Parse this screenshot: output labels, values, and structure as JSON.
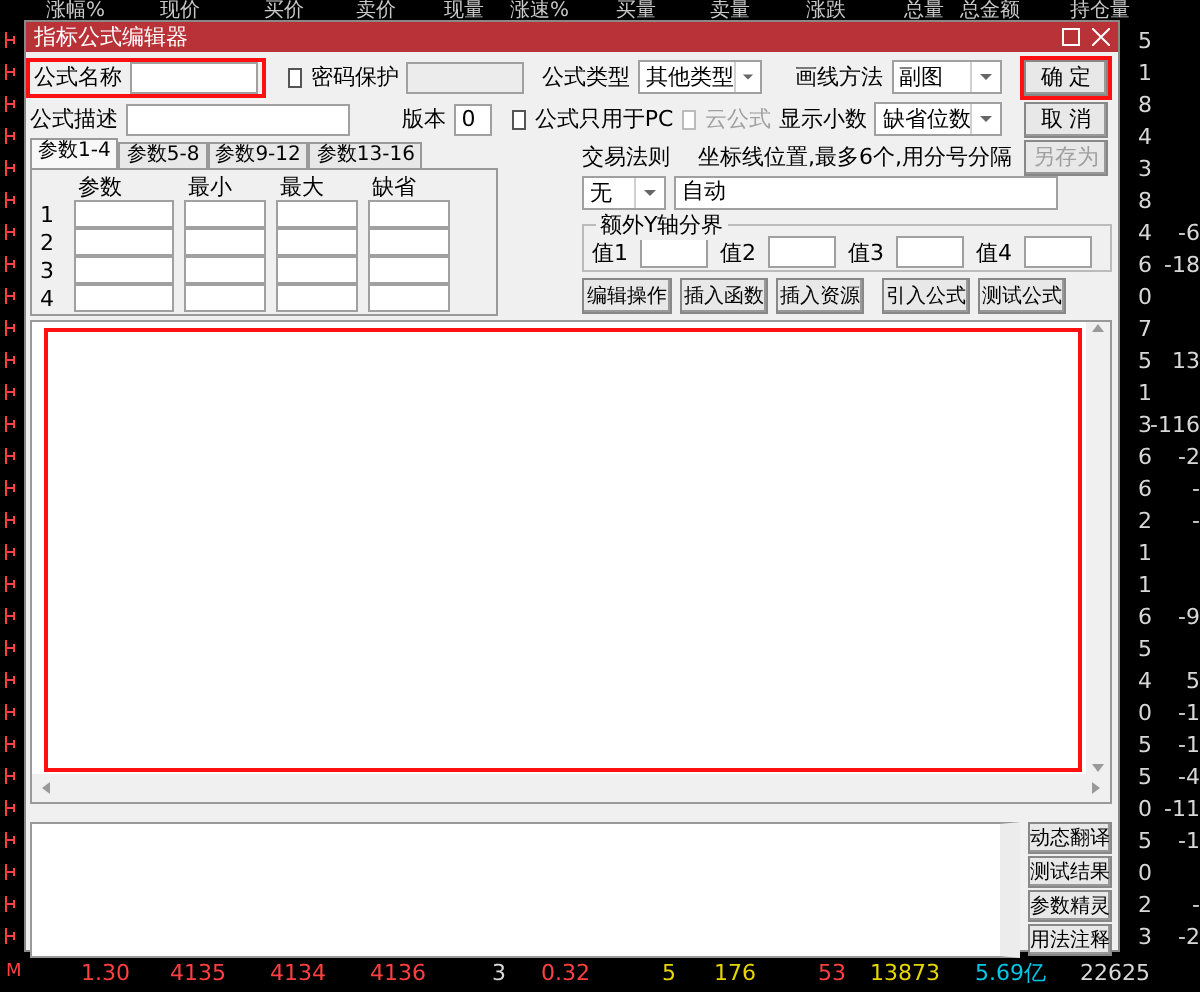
{
  "market": {
    "header": [
      "涨幅%",
      "现价",
      "买价",
      "卖价",
      "现量",
      "涨速%",
      "买量",
      "卖量",
      "涨跌",
      "总量",
      "总金额",
      "持仓量"
    ],
    "rows": [
      {
        "c1": "5"
      },
      {
        "c1": "1"
      },
      {
        "c1": "8"
      },
      {
        "c1": "4"
      },
      {
        "c1": "3"
      },
      {
        "c1": "8"
      },
      {
        "c1": "4",
        "c2": "-6"
      },
      {
        "c1": "6",
        "c2": "-18"
      },
      {
        "c1": "0"
      },
      {
        "c1": "7"
      },
      {
        "c1": "5",
        "c2": "13"
      },
      {
        "c1": "1"
      },
      {
        "c1": "3",
        "c2": "-116"
      },
      {
        "c1": "6",
        "c2": "-2"
      },
      {
        "c1": "6",
        "c2": "-"
      },
      {
        "c1": "2",
        "c2": "-"
      },
      {
        "c1": "1"
      },
      {
        "c1": "1"
      },
      {
        "c1": "6",
        "c2": "-9"
      },
      {
        "c1": "5"
      },
      {
        "c1": "4",
        "c2": "5"
      },
      {
        "c1": "0",
        "c2": "-1"
      },
      {
        "c1": "5",
        "c2": "-1"
      },
      {
        "c1": "5",
        "c2": "-4"
      },
      {
        "c1": "0",
        "c2": "-11"
      },
      {
        "c1": "5",
        "c2": "-1"
      },
      {
        "c1": "0"
      },
      {
        "c1": "2",
        "c2": "-"
      },
      {
        "c1": "3",
        "c2": "-2"
      }
    ],
    "footer_marker": "M",
    "footer": [
      {
        "text": "1.30",
        "color": "#ff4040"
      },
      {
        "text": "4135",
        "color": "#ff4040"
      },
      {
        "text": "4134",
        "color": "#ff4040"
      },
      {
        "text": "4136",
        "color": "#ff4040"
      },
      {
        "text": "3",
        "color": "#d8d8d8"
      },
      {
        "text": "0.32",
        "color": "#ff4040"
      },
      {
        "text": "5",
        "color": "#e6d600"
      },
      {
        "text": "176",
        "color": "#e6d600"
      },
      {
        "text": "53",
        "color": "#ff4040"
      },
      {
        "text": "13873",
        "color": "#e6d600"
      },
      {
        "text": "5.69亿",
        "color": "#00c8e6"
      },
      {
        "text": "22625",
        "color": "#d8d8d8"
      }
    ]
  },
  "dialog": {
    "title": "指标公式编辑器",
    "name_field": {
      "label": "公式名称",
      "highlighted": true
    },
    "password": {
      "label": "密码保护",
      "checked": false
    },
    "formula_type": {
      "label": "公式类型",
      "value": "其他类型"
    },
    "draw_method": {
      "label": "画线方法",
      "value": "副图"
    },
    "description": {
      "label": "公式描述"
    },
    "version": {
      "label": "版本",
      "value": "0"
    },
    "pc_only": {
      "label": "公式只用于PC",
      "checked": false
    },
    "cloud": {
      "label": "云公式",
      "checked": false,
      "disabled": true
    },
    "decimals": {
      "label": "显示小数",
      "value": "缺省位数"
    },
    "buttons": [
      {
        "label": "确  定",
        "highlighted": true,
        "disabled": false
      },
      {
        "label": "取  消",
        "highlighted": false,
        "disabled": false
      },
      {
        "label": "另存为",
        "highlighted": false,
        "disabled": true
      }
    ],
    "tabs": [
      {
        "label": "参数1-4",
        "selected": true
      },
      {
        "label": "参数5-8",
        "selected": false
      },
      {
        "label": "参数9-12",
        "selected": false
      },
      {
        "label": "参数13-16",
        "selected": false
      }
    ],
    "params": {
      "columns": [
        "参数",
        "最小",
        "最大",
        "缺省"
      ],
      "rows": [
        "1",
        "2",
        "3",
        "4"
      ]
    },
    "trade_rule": {
      "label": "交易法则",
      "value": "无"
    },
    "axis": {
      "label": "坐标线位置,最多6个,用分号分隔",
      "value": "自动"
    },
    "extra_axis": {
      "title": "额外Y轴分界",
      "fields": [
        "值1",
        "值2",
        "值3",
        "值4"
      ]
    },
    "tools": [
      "编辑操作",
      "插入函数",
      "插入资源",
      "引入公式",
      "测试公式"
    ],
    "editor": {
      "highlighted": true
    },
    "side_buttons": [
      "动态翻译",
      "测试结果",
      "参数精灵",
      "用法注释"
    ]
  }
}
